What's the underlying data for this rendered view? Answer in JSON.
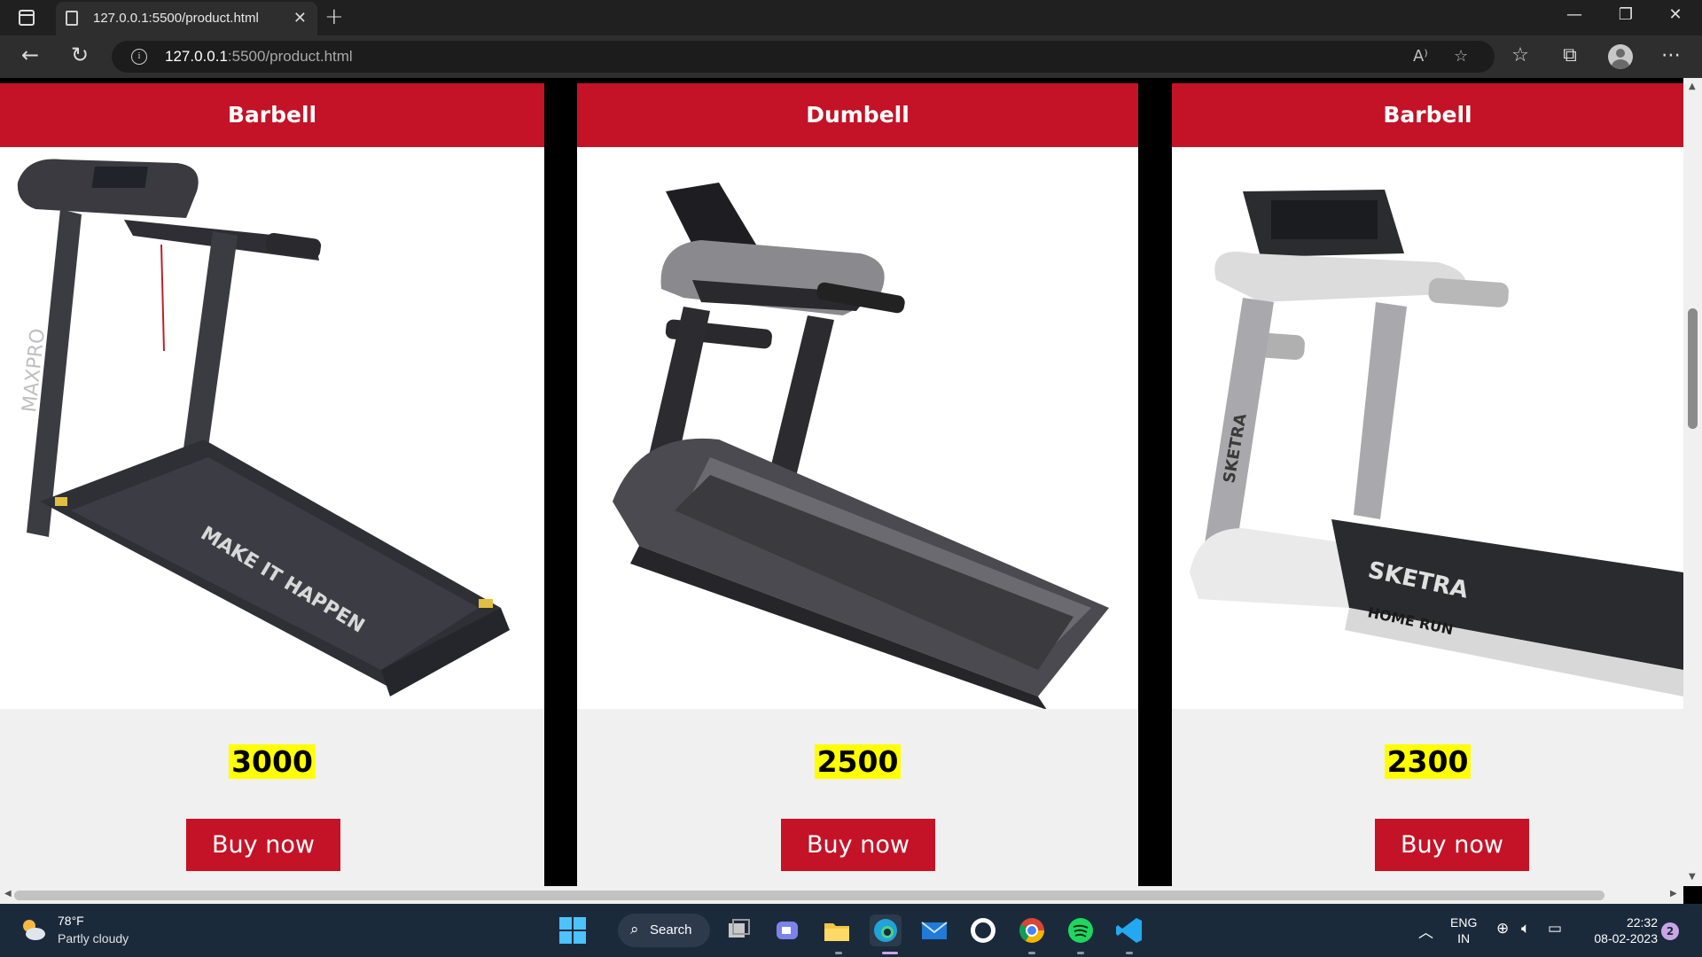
{
  "browser": {
    "tab_title": "127.0.0.1:5500/product.html",
    "url_host": "127.0.0.1",
    "url_path": ":5500/product.html",
    "read_aloud_label": "A⁾"
  },
  "products": [
    {
      "title": "Barbell",
      "price": "3000",
      "button": "Buy now",
      "image": "treadmill-maxpro-dark",
      "image_text": "MAKE IT HAPPEN",
      "brand_text": "MAXPRO"
    },
    {
      "title": "Dumbell",
      "price": "2500",
      "button": "Buy now",
      "image": "treadmill-commercial-black",
      "image_text": "",
      "brand_text": ""
    },
    {
      "title": "Barbell",
      "price": "2300",
      "button": "Buy now",
      "image": "treadmill-sketra-white",
      "image_text": "HOME RUN",
      "brand_text": "SKETRA"
    }
  ],
  "taskbar": {
    "weather_temp": "78°F",
    "weather_condition": "Partly cloudy",
    "search_label": "Search",
    "lang_line1": "ENG",
    "lang_line2": "IN",
    "time": "22:32",
    "date": "08-02-2023",
    "notification_count": "2"
  },
  "colors": {
    "accent_red": "#c41226",
    "price_highlight": "#ffff00",
    "taskbar_bg": "#1b2a3b"
  }
}
